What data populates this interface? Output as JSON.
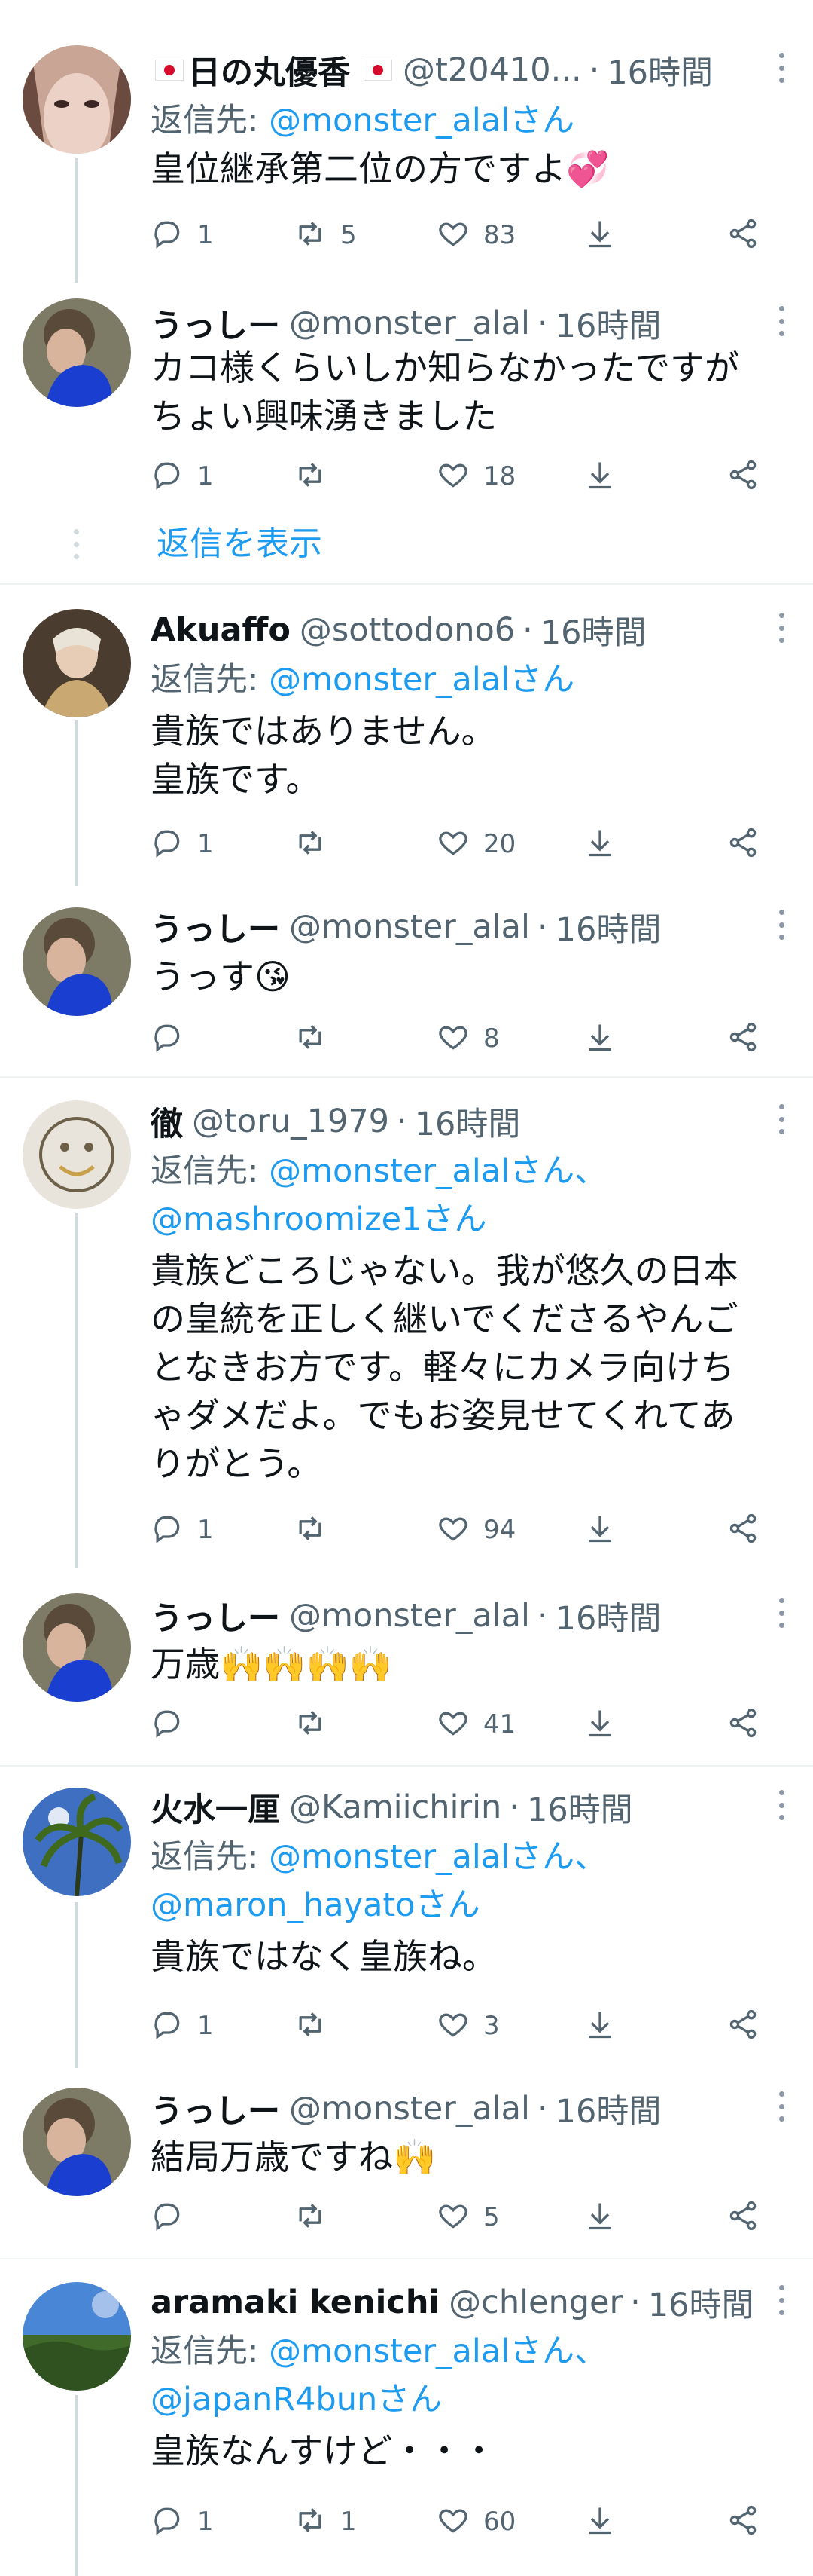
{
  "ui": {
    "reply_prefix": "返信先: ",
    "reply_suffix": "さん",
    "sep": "、",
    "show_replies": "返信を表示",
    "dot": "·"
  },
  "tweets": [
    {
      "name": "日の丸優香",
      "handle": "@t20410...",
      "time": "16時間",
      "replying_to": [
        "@monster_alal"
      ],
      "text": "皇位継承第二位の方ですよ💞",
      "counts": {
        "reply": "1",
        "retweet": "5",
        "like": "83"
      }
    },
    {
      "name": "うっしー",
      "handle": "@monster_alal",
      "time": "16時間",
      "replying_to": [],
      "text": "カコ様くらいしか知らなかったですが\nちょい興味湧きました",
      "counts": {
        "reply": "1",
        "retweet": "",
        "like": "18"
      }
    },
    {
      "name": "Akuaffo",
      "handle": "@sottodono6",
      "time": "16時間",
      "replying_to": [
        "@monster_alal"
      ],
      "text": "貴族ではありません。\n皇族です。",
      "counts": {
        "reply": "1",
        "retweet": "",
        "like": "20"
      }
    },
    {
      "name": "うっしー",
      "handle": "@monster_alal",
      "time": "16時間",
      "replying_to": [],
      "text": "うっす😘",
      "counts": {
        "reply": "",
        "retweet": "",
        "like": "8"
      }
    },
    {
      "name": "徹",
      "handle": "@toru_1979",
      "time": "16時間",
      "replying_to": [
        "@monster_alal",
        "@mashroomize1"
      ],
      "text": "貴族どころじゃない。我が悠久の日本\nの皇統を正しく継いでくださるやんご\nとなきお方です。軽々にカメラ向けち\nゃダメだよ。でもお姿見せてくれてあ\nりがとう。",
      "counts": {
        "reply": "1",
        "retweet": "",
        "like": "94"
      }
    },
    {
      "name": "うっしー",
      "handle": "@monster_alal",
      "time": "16時間",
      "replying_to": [],
      "text": "万歳🙌🙌🙌🙌",
      "counts": {
        "reply": "",
        "retweet": "",
        "like": "41"
      }
    },
    {
      "name": "火水一厘",
      "handle": "@Kamiichirin",
      "time": "16時間",
      "replying_to": [
        "@monster_alal",
        "@maron_hayato"
      ],
      "text": "貴族ではなく皇族ね。",
      "counts": {
        "reply": "1",
        "retweet": "",
        "like": "3"
      }
    },
    {
      "name": "うっしー",
      "handle": "@monster_alal",
      "time": "16時間",
      "replying_to": [],
      "text": "結局万歳ですね🙌",
      "counts": {
        "reply": "",
        "retweet": "",
        "like": "5"
      }
    },
    {
      "name": "aramaki kenichi",
      "handle": "@chlenger",
      "time": "16時間",
      "replying_to": [
        "@monster_alal",
        "@japanR4bun"
      ],
      "text": "皇族なんすけど・・・",
      "counts": {
        "reply": "1",
        "retweet": "1",
        "like": "60"
      }
    }
  ],
  "icons": {
    "reply": "reply-icon",
    "retweet": "retweet-icon",
    "like": "heart-icon",
    "download": "download-icon",
    "share": "share-icon",
    "more": "more-icon"
  },
  "colors": {
    "link": "#1d9bf0",
    "meta": "#536471",
    "text": "#0f1419",
    "thread_line": "#cfd9de"
  }
}
